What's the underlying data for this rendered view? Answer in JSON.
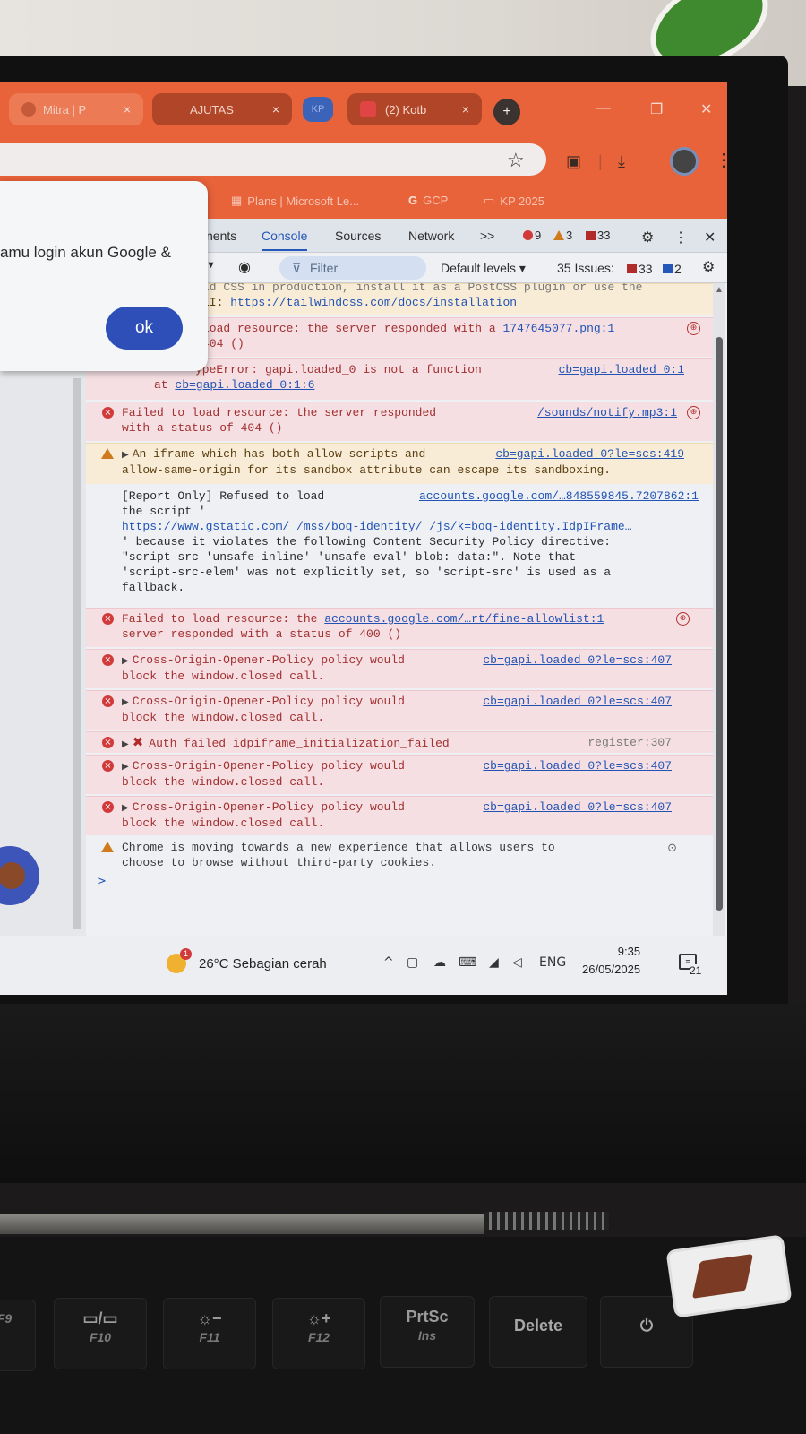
{
  "browser": {
    "tabs": [
      {
        "label": "Mitra | P"
      },
      {
        "label": "AJUTAS"
      },
      {
        "label": "KP"
      },
      {
        "label": "(2) Kotb"
      }
    ],
    "new_tab": "+",
    "close_glyph": "×",
    "minimize_glyph": "—",
    "maximize_glyph": "❐",
    "close_window_glyph": "✕"
  },
  "bookmarks": [
    {
      "label": "Plans | Microsoft Le...",
      "icon": "microsoft-icon"
    },
    {
      "label": "GCP",
      "icon": "google-icon"
    },
    {
      "label": "KP 2025",
      "icon": "folder-icon"
    }
  ],
  "dialog": {
    "message": "amu login akun Google &",
    "ok_label": "ok"
  },
  "devtools": {
    "tabs": [
      {
        "label": "nents"
      },
      {
        "label": "Console",
        "active": true
      },
      {
        "label": "Sources"
      },
      {
        "label": "Network"
      },
      {
        "label": ">>"
      }
    ],
    "counts": {
      "errors": "9",
      "warnings": "3",
      "issues": "33"
    },
    "toolbar": {
      "filter_placeholder": "Filter",
      "levels": "Default levels ▾",
      "issues_label": "35 Issues:",
      "issues_red": "33",
      "issues_blue": "2"
    }
  },
  "console": {
    "rows": [
      {
        "type": "warn",
        "text": "ld CSS in production, install it as a PostCSS plugin or use the",
        "text2": "LI: ",
        "link": "https://tailwindcss.com/docs/installation"
      },
      {
        "type": "err",
        "text": "load resource: the server responded with a ",
        "src": "1747645077.png:1",
        "text2": "404 ()"
      },
      {
        "type": "err",
        "text": "ypeError: gapi.loaded_0 is not a function",
        "src": "cb=gapi.loaded_0:1",
        "text2": "at ",
        "link": "cb=gapi.loaded_0:1:6"
      },
      {
        "type": "err",
        "text": "Failed to load resource: the server responded",
        "src": "/sounds/notify.mp3:1",
        "text2": "with a status of 404 ()"
      },
      {
        "type": "warn",
        "text": "An iframe which has both allow-scripts and ",
        "src": "cb=gapi.loaded_0?le=scs:419",
        "text2": "allow-same-origin for its sandbox attribute can escape its sandboxing."
      },
      {
        "type": "info",
        "text": "[Report Only] Refused to load",
        "src": "accounts.google.com/…848559845.7207862:1",
        "lines": [
          "the script '",
          "https://www.gstatic.com/_/mss/boq-identity/_/js/k=boq-identity.IdpIFrame…",
          "' because it violates the following Content Security Policy directive:",
          "\"script-src 'unsafe-inline' 'unsafe-eval' blob: data:\". Note that",
          "'script-src-elem' was not explicitly set, so 'script-src' is used as a",
          "fallback."
        ]
      },
      {
        "type": "err",
        "text": "Failed to load resource: the ",
        "link": "accounts.google.com/…rt/fine-allowlist:1",
        "text2": "server responded with a status of 400 ()"
      },
      {
        "type": "err",
        "text": "Cross-Origin-Opener-Policy policy would",
        "src": "cb=gapi.loaded_0?le=scs:407",
        "text2": "block the window.closed call."
      },
      {
        "type": "err",
        "text": "Cross-Origin-Opener-Policy policy would",
        "src": "cb=gapi.loaded_0?le=scs:407",
        "text2": "block the window.closed call."
      },
      {
        "type": "err",
        "text": "Auth failed idpiframe_initialization_failed",
        "src": "register:307"
      },
      {
        "type": "err",
        "text": "Cross-Origin-Opener-Policy policy would",
        "src": "cb=gapi.loaded_0?le=scs:407",
        "text2": "block the window.closed call."
      },
      {
        "type": "err",
        "text": "Cross-Origin-Opener-Policy policy would",
        "src": "cb=gapi.loaded_0?le=scs:407",
        "text2": "block the window.closed call."
      },
      {
        "type": "warn",
        "text": "Chrome is moving towards a new experience that allows users to",
        "text2": "choose to browse without third-party cookies."
      }
    ],
    "prompt": ">"
  },
  "taskbar": {
    "weather": "26°C  Sebagian cerah",
    "language": "ENG",
    "time": "9:35",
    "date": "26/05/2025",
    "notification_count": "21"
  },
  "keyboard": {
    "keys": [
      {
        "top": "",
        "bottom": "F9"
      },
      {
        "top": "▭/▭",
        "bottom": "F10"
      },
      {
        "top": "☼−",
        "bottom": "F11"
      },
      {
        "top": "☼+",
        "bottom": "F12"
      },
      {
        "top": "PrtSc",
        "bottom": "Ins"
      },
      {
        "top": "Delete",
        "bottom": ""
      },
      {
        "top": "⏻",
        "bottom": ""
      }
    ]
  }
}
